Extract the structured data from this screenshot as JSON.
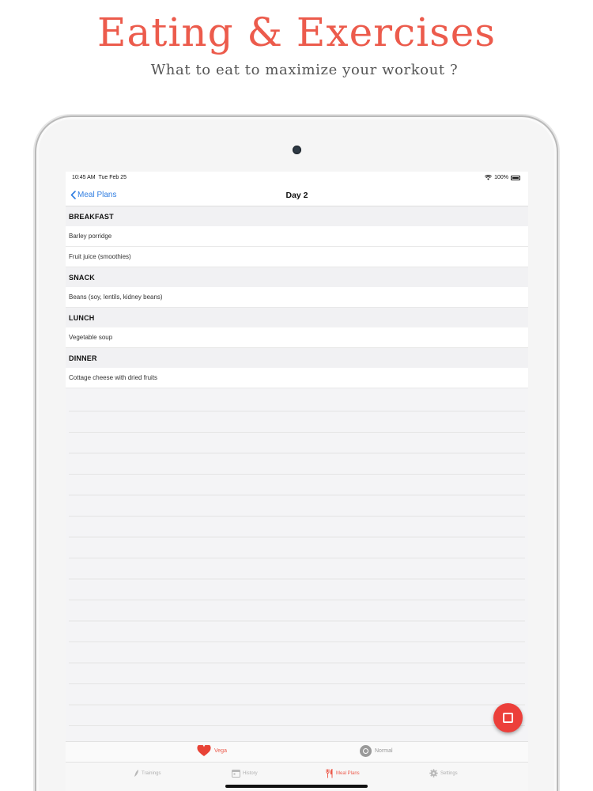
{
  "promo": {
    "title": "Eating & Exercises",
    "subtitle": "What to eat to maximize your workout ?"
  },
  "status_bar": {
    "time": "10:45 AM",
    "date": "Tue Feb 25",
    "battery": "100%"
  },
  "nav": {
    "back_label": "Meal Plans",
    "title": "Day 2"
  },
  "sections": [
    {
      "header": "BREAKFAST",
      "items": [
        "Barley porridge",
        "Fruit juice (smoothies)"
      ]
    },
    {
      "header": "SNACK",
      "items": [
        "Beans (soy, lentils, kidney beans)"
      ]
    },
    {
      "header": "LUNCH",
      "items": [
        "Vegetable soup"
      ]
    },
    {
      "header": "DINNER",
      "items": [
        "Cottage cheese with dried fruits"
      ]
    }
  ],
  "segments": {
    "vega": "Vega",
    "normal": "Normal",
    "selected": "Vega"
  },
  "tabs": {
    "trainings": "Trainings",
    "history": "History",
    "meal_plans": "Meal Plans",
    "settings": "Settings",
    "active": "Meal Plans"
  },
  "colors": {
    "accent": "#ec5b4c",
    "link": "#2f7de1",
    "fab": "#ec3f3a"
  },
  "icons": {
    "back": "chevron-left-icon",
    "fab": "square-icon",
    "vega": "heart-icon",
    "normal": "plate-icon",
    "trainings": "feather-icon",
    "history": "calendar-icon",
    "meal_plans": "fork-knife-icon",
    "settings": "gear-icon"
  }
}
